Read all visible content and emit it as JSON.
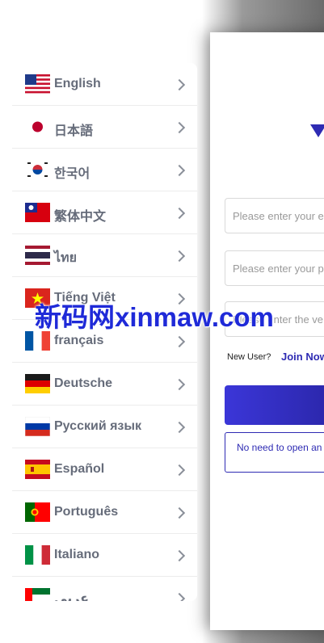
{
  "background": {
    "email_placeholder": "Please enter your e",
    "password_placeholder": "Please enter your p",
    "verify_placeholder": "Please enter the ve",
    "new_user_label": "New User?",
    "join_now_label": "Join Now",
    "notice_text": "No need to open an"
  },
  "languages": [
    {
      "label": "English",
      "flag": "us-flag-icon"
    },
    {
      "label": "日本語",
      "flag": "japan-flag-icon"
    },
    {
      "label": "한국어",
      "flag": "korea-flag-icon"
    },
    {
      "label": "繁体中文",
      "flag": "taiwan-flag-icon"
    },
    {
      "label": "ไทย",
      "flag": "thailand-flag-icon"
    },
    {
      "label": "Tiếng Việt",
      "flag": "vietnam-flag-icon"
    },
    {
      "label": "français",
      "flag": "france-flag-icon"
    },
    {
      "label": "Deutsche",
      "flag": "germany-flag-icon"
    },
    {
      "label": "Русский язык",
      "flag": "russia-flag-icon"
    },
    {
      "label": "Español",
      "flag": "spain-flag-icon"
    },
    {
      "label": "Português",
      "flag": "portugal-flag-icon"
    },
    {
      "label": "Italiano",
      "flag": "italy-flag-icon"
    },
    {
      "label": "عربي",
      "flag": "uae-flag-icon"
    }
  ],
  "watermark": "新码网xinmaw.com",
  "colors": {
    "accent": "#2e2bb3",
    "label": "#666c7a"
  }
}
